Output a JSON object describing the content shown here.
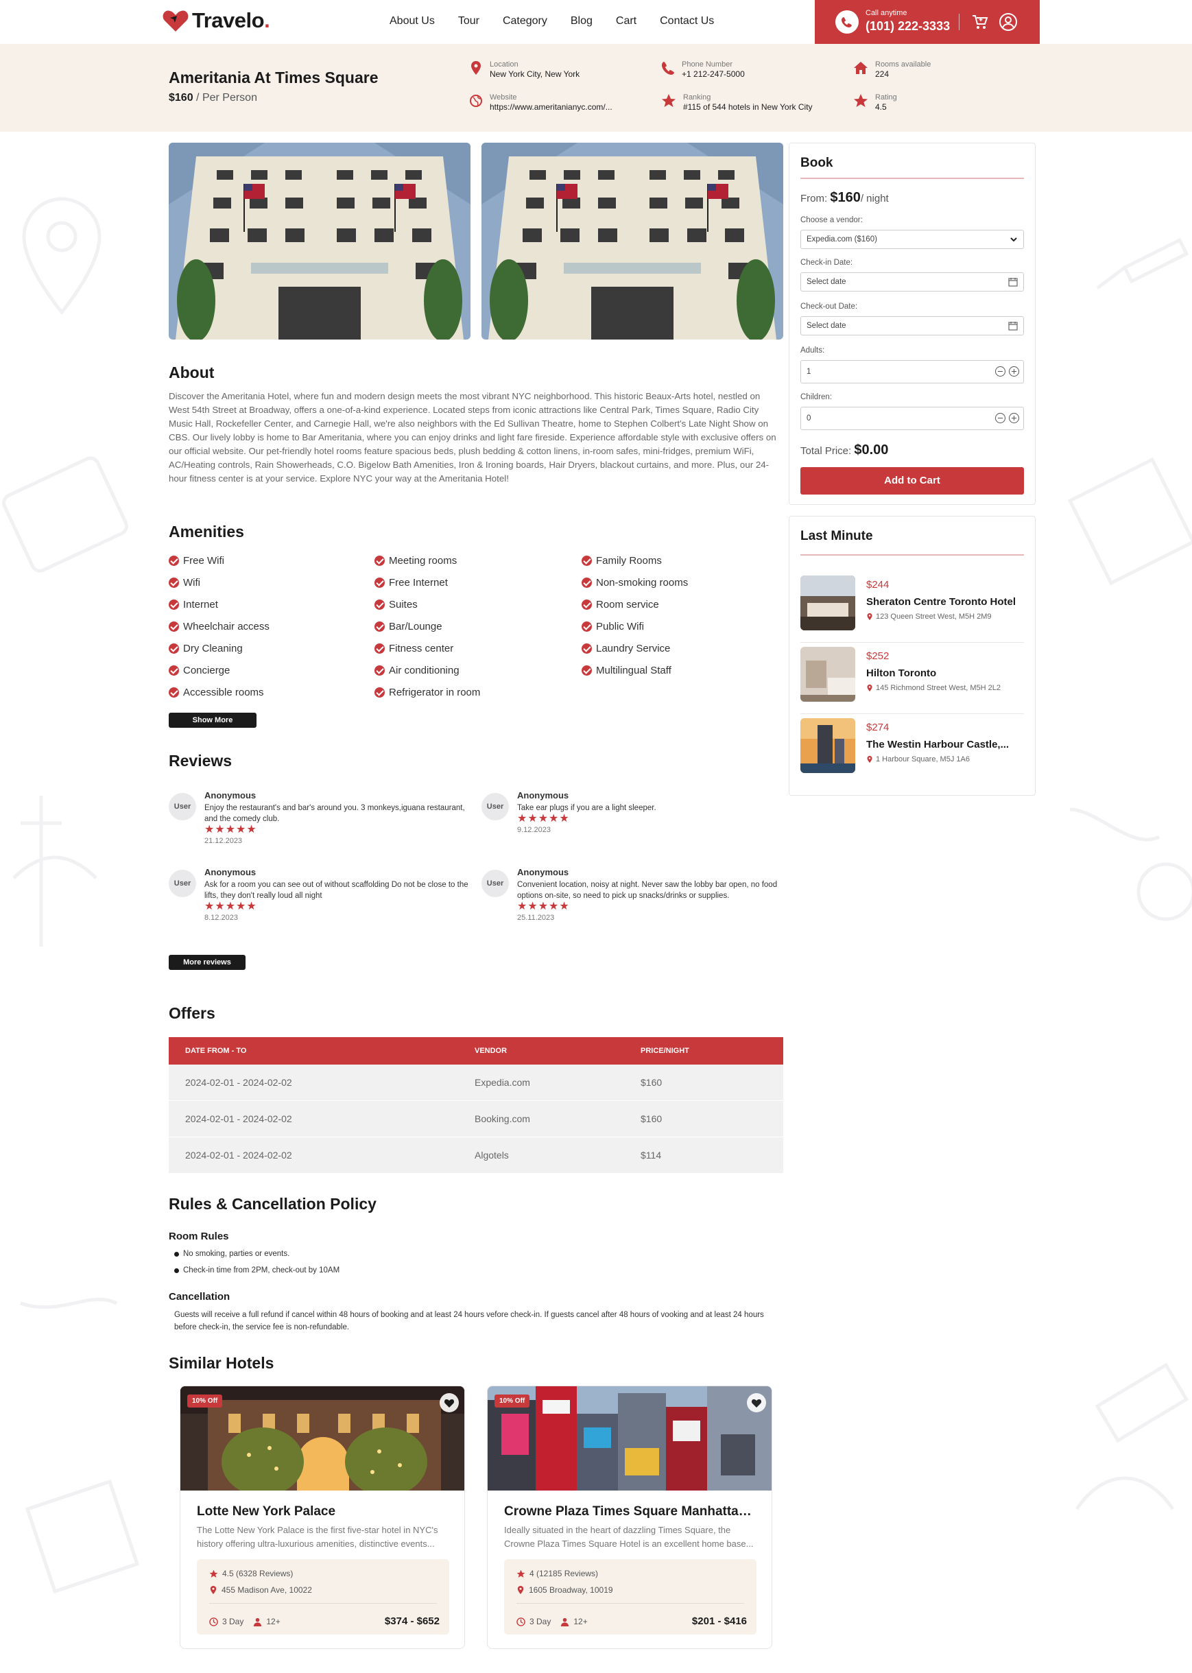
{
  "header": {
    "logo_text": "Travelo",
    "nav": [
      "About Us",
      "Tour",
      "Category",
      "Blog",
      "Cart",
      "Contact Us"
    ],
    "call_label": "Call anytime",
    "call_number": "(101) 222-3333"
  },
  "hotel": {
    "name": "Ameritania At Times Square",
    "price": "$160",
    "price_suffix": "/ Per Person",
    "info": {
      "location_label": "Location",
      "location": "New York City, New York",
      "phone_label": "Phone Number",
      "phone": "+1 212-247-5000",
      "rooms_label": "Rooms available",
      "rooms": "224",
      "website_label": "Website",
      "website": "https://www.ameritanianyc.com/...",
      "ranking_label": "Ranking",
      "ranking": "#115 of 544 hotels in New York City",
      "rating_label": "Rating",
      "rating": "4.5"
    }
  },
  "about": {
    "title": "About",
    "text": "Discover the Ameritania Hotel, where fun and modern design meets the most vibrant NYC neighborhood. This historic Beaux-Arts hotel, nestled on West 54th Street at Broadway, offers a one-of-a-kind experience. Located steps from iconic attractions like Central Park, Times Square, Radio City Music Hall, Rockefeller Center, and Carnegie Hall, we're also neighbors with the Ed Sullivan Theatre, home to Stephen Colbert's Late Night Show on CBS. Our lively lobby is home to Bar Ameritania, where you can enjoy drinks and light fare fireside. Experience affordable style with exclusive offers on our official website. Our pet-friendly hotel rooms feature spacious beds, plush bedding & cotton linens, in-room safes, mini-fridges, premium WiFi, AC/Heating controls, Rain Showerheads, C.O. Bigelow Bath Amenities, Iron & Ironing boards, Hair Dryers, blackout curtains, and more. Plus, our 24-hour fitness center is at your service. Explore NYC your way at the Ameritania Hotel!"
  },
  "amenities": {
    "title": "Amenities",
    "col1": [
      "Free Wifi",
      "Wifi",
      "Internet",
      "Wheelchair access",
      "Dry Cleaning",
      "Concierge",
      "Accessible rooms"
    ],
    "col2": [
      "Meeting rooms",
      "Free Internet",
      "Suites",
      "Bar/Lounge",
      "Fitness center",
      "Air conditioning",
      "Refrigerator in room"
    ],
    "col3": [
      "Family Rooms",
      "Non-smoking rooms",
      "Room service",
      "Public Wifi",
      "Laundry Service",
      "Multilingual Staff"
    ],
    "show_more": "Show More"
  },
  "reviews": {
    "title": "Reviews",
    "avatar_label": "User",
    "stars": "★★★★★",
    "items": [
      {
        "name": "Anonymous",
        "text": "Enjoy the restaurant's and bar's around you. 3 monkeys,iguana restaurant, and the comedy club.",
        "date": "21.12.2023"
      },
      {
        "name": "Anonymous",
        "text": "Take ear plugs if you are a light sleeper.",
        "date": "9.12.2023"
      },
      {
        "name": "Anonymous",
        "text": "Ask for a room you can see out of without scaffolding Do not be close to the lifts, they don't really loud all night",
        "date": "8.12.2023"
      },
      {
        "name": "Anonymous",
        "text": "Convenient location, noisy at night. Never saw the lobby bar open, no food options on-site, so need to pick up snacks/drinks or supplies.",
        "date": "25.11.2023"
      }
    ],
    "more": "More reviews"
  },
  "offers": {
    "title": "Offers",
    "headers": [
      "DATE FROM - TO",
      "VENDOR",
      "PRICE/NIGHT"
    ],
    "rows": [
      [
        "2024-02-01 - 2024-02-02",
        "Expedia.com",
        "$160"
      ],
      [
        "2024-02-01 - 2024-02-02",
        "Booking.com",
        "$160"
      ],
      [
        "2024-02-01 - 2024-02-02",
        "Algotels",
        "$114"
      ]
    ]
  },
  "rules": {
    "title": "Rules & Cancellation Policy",
    "room_rules_title": "Room Rules",
    "room_rules": [
      "No smoking, parties or events.",
      "Check-in time from 2PM, check-out by 10AM"
    ],
    "cancellation_title": "Cancellation",
    "cancellation_text": "Guests will receive a full refund if cancel within 48 hours of booking and at least 24 hours vefore check-in. If guests cancel after 48 hours of vooking and at least 24 hours before check-in, the service fee is non-refundable."
  },
  "similar": {
    "title": "Similar Hotels",
    "cards": [
      {
        "badge": "10% Off",
        "name": "Lotte New York Palace",
        "desc": "The Lotte New York Palace is the first five-star hotel in NYC's history offering ultra-luxurious amenities, distinctive events...",
        "rating": "4.5 (6328 Reviews)",
        "address": "455 Madison Ave, 10022",
        "days": "3 Day",
        "age": "12+",
        "price": "$374 - $652"
      },
      {
        "badge": "10% Off",
        "name": "Crowne Plaza Times Square Manhattan,...",
        "desc": "Ideally situated in the heart of dazzling Times Square, the Crowne Plaza Times Square Hotel is an excellent home base...",
        "rating": "4 (12185 Reviews)",
        "address": "1605 Broadway, 10019",
        "days": "3 Day",
        "age": "12+",
        "price": "$201 - $416"
      }
    ]
  },
  "book": {
    "title": "Book",
    "from_label": "From:",
    "from_price": "$160",
    "from_suffix": "/ night",
    "vendor_label": "Choose a vendor:",
    "vendor_value": "Expedia.com ($160)",
    "checkin_label": "Check-in Date:",
    "checkin_placeholder": "Select date",
    "checkout_label": "Check-out Date:",
    "checkout_placeholder": "Select date",
    "adults_label": "Adults:",
    "adults_value": "1",
    "children_label": "Children:",
    "children_value": "0",
    "total_label": "Total Price:",
    "total_value": "$0.00",
    "add_to_cart": "Add to Cart"
  },
  "last_minute": {
    "title": "Last Minute",
    "items": [
      {
        "price": "$244",
        "name": "Sheraton Centre Toronto Hotel",
        "address": "123 Queen Street West, M5H 2M9"
      },
      {
        "price": "$252",
        "name": "Hilton Toronto",
        "address": "145 Richmond Street West, M5H 2L2"
      },
      {
        "price": "$274",
        "name": "The Westin Harbour Castle,...",
        "address": "1 Harbour Square, M5J 1A6"
      }
    ]
  },
  "colors": {
    "accent": "#c8393b",
    "dark": "#1b1b1b",
    "strip": "#f7f1ea"
  }
}
